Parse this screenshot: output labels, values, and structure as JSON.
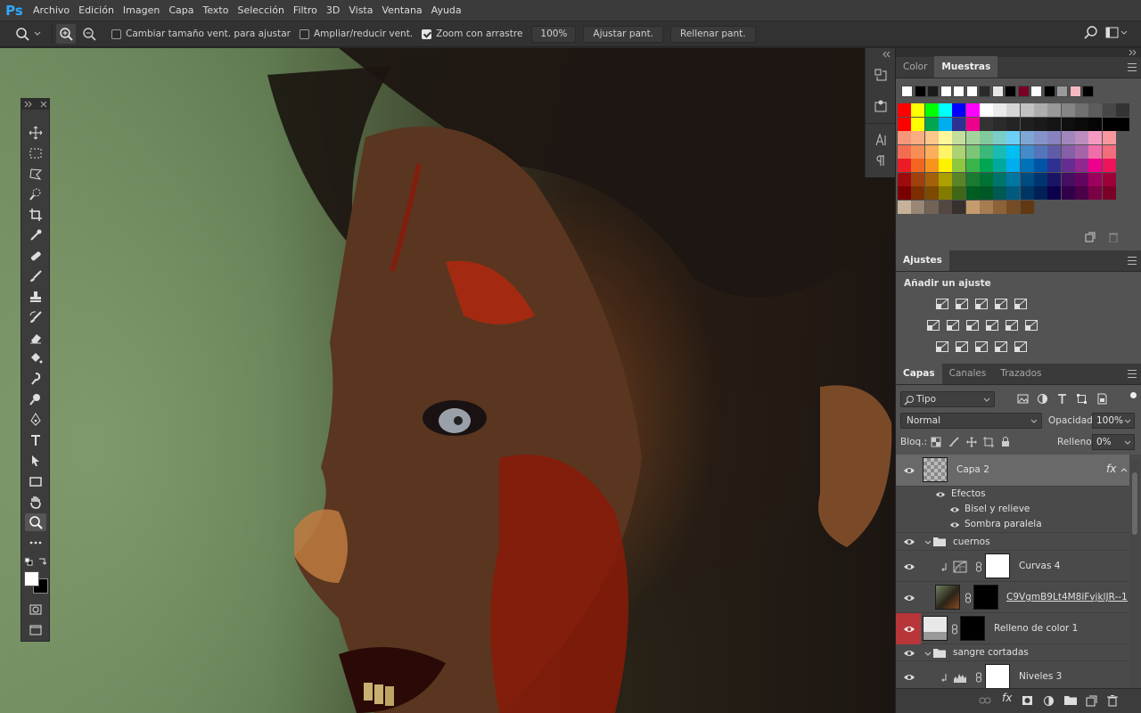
{
  "app": {
    "logo": "Ps"
  },
  "menu": [
    "Archivo",
    "Edición",
    "Imagen",
    "Capa",
    "Texto",
    "Selección",
    "Filtro",
    "3D",
    "Vista",
    "Ventana",
    "Ayuda"
  ],
  "options": {
    "resize_label": "Cambiar tamaño vent. para ajustar",
    "resize_checked": false,
    "zoom_all_label": "Ampliar/reducir vent.",
    "zoom_all_checked": false,
    "scrubby_label": "Zoom con arrastre",
    "scrubby_checked": true,
    "zoom_value": "100%",
    "fit_label": "Ajustar pant.",
    "fill_label": "Rellenar pant."
  },
  "swatches_panel": {
    "tabs": [
      "Color",
      "Muestras"
    ],
    "active_tab": "Muestras",
    "recent": [
      "#ffffff",
      "#000000",
      "#1a1a1a",
      "#ffffff",
      "#ffffff",
      "#ffffff",
      "#2a2a2a",
      "#e8e8e8",
      "#000000",
      "#7a0026",
      "#ffffff",
      "#000000",
      "#9a9a9a",
      "#f5b8c0",
      "#000000"
    ],
    "rows": [
      [
        "#ff0000",
        "#ffff00",
        "#00ff00",
        "#00ffff",
        "#0000ff",
        "#ff00ff",
        "#ffffff",
        "#ebebeb",
        "#d6d6d6",
        "#c2c2c2",
        "#adadad",
        "#999999",
        "#858585",
        "#707070",
        "#5c5c5c",
        "#474747",
        "#333333"
      ],
      [
        "#ff0000",
        "#ffff00",
        "#00a650",
        "#00aeef",
        "#2e3192",
        "#ec008c",
        "#333333",
        "#2b2b2b",
        "#242424",
        "#1f1f1f",
        "#1a1a1a",
        "#141414",
        "#0f0f0f",
        "#0a0a0a",
        "#050505",
        "#000000",
        "#000000"
      ],
      [
        "#f7977a",
        "#f9ad81",
        "#fdc68a",
        "#fff79a",
        "#c4df9b",
        "#a3d39c",
        "#82ca9d",
        "#7bcdc8",
        "#6ecff6",
        "#7ea7d8",
        "#8493ca",
        "#8882be",
        "#a187be",
        "#bc8dbf",
        "#f49ac2",
        "#f6989d"
      ],
      [
        "#f26c4f",
        "#f68e55",
        "#fbaf5c",
        "#fff467",
        "#acd372",
        "#7cc576",
        "#3bb878",
        "#1abbb4",
        "#00bff3",
        "#438cca",
        "#5574b9",
        "#605ca8",
        "#855fa8",
        "#a763a8",
        "#f06ea9",
        "#f26d7d"
      ],
      [
        "#ed1c24",
        "#f26522",
        "#f7941d",
        "#fff200",
        "#8dc73f",
        "#39b54a",
        "#00a651",
        "#00a99d",
        "#00aeef",
        "#0072bc",
        "#0054a6",
        "#2e3192",
        "#662d91",
        "#92278f",
        "#ec008c",
        "#ed145b"
      ],
      [
        "#9e0b0f",
        "#a0410d",
        "#a3620a",
        "#aba000",
        "#598527",
        "#1a7b30",
        "#007236",
        "#00746b",
        "#0076a3",
        "#004b80",
        "#003471",
        "#1b1464",
        "#440e62",
        "#630460",
        "#9e005d",
        "#9e0039"
      ],
      [
        "#790000",
        "#7b2e00",
        "#7d4900",
        "#827b00",
        "#406618",
        "#005e20",
        "#005826",
        "#005952",
        "#005b7f",
        "#003663",
        "#002157",
        "#0d004c",
        "#32004b",
        "#4b0049",
        "#7b0046",
        "#7a0026"
      ],
      [
        "#c7b299",
        "#998675",
        "#736357",
        "#534741",
        "#37302d",
        "#c69c6d",
        "#a67c52",
        "#8c6239",
        "#754c24",
        "#603913"
      ]
    ]
  },
  "adjustments": {
    "tab": "Ajustes",
    "heading": "Añadir un ajuste",
    "row1": [
      "brightness-icon",
      "levels-icon",
      "curves-icon",
      "exposure-icon",
      "vibrance-icon"
    ],
    "row2": [
      "hue-saturation-icon",
      "color-balance-icon",
      "black-white-icon",
      "photo-filter-icon",
      "channel-mixer-icon",
      "color-lookup-icon"
    ],
    "row3": [
      "invert-icon",
      "posterize-icon",
      "threshold-icon",
      "selective-color-icon",
      "gradient-map-icon"
    ]
  },
  "layers_panel": {
    "tabs": [
      "Capas",
      "Canales",
      "Trazados"
    ],
    "active_tab": "Capas",
    "filter_label": "Tipo",
    "blend_mode": "Normal",
    "opacity_label": "Opacidad:",
    "opacity_value": "100%",
    "lock_label": "Bloq.:",
    "fill_label": "Relleno:",
    "fill_value": "0%",
    "layers": [
      {
        "name": "Capa 2",
        "kind": "layer-transparent",
        "fx": "fx",
        "selected": true
      },
      {
        "name": "Efectos",
        "kind": "effects-header"
      },
      {
        "name": "Bisel y relieve",
        "kind": "effect"
      },
      {
        "name": "Sombra paralela",
        "kind": "effect"
      },
      {
        "name": "cuernos",
        "kind": "group"
      },
      {
        "name": "Curvas 4",
        "kind": "adjustment"
      },
      {
        "name": "C9VgmB9Lt4M8iFvjklJR--1...",
        "kind": "smart-object"
      },
      {
        "name": "Relleno de color 1",
        "kind": "fill"
      },
      {
        "name": "sangre cortadas",
        "kind": "group"
      },
      {
        "name": "Niveles 3",
        "kind": "adjustment"
      }
    ]
  }
}
